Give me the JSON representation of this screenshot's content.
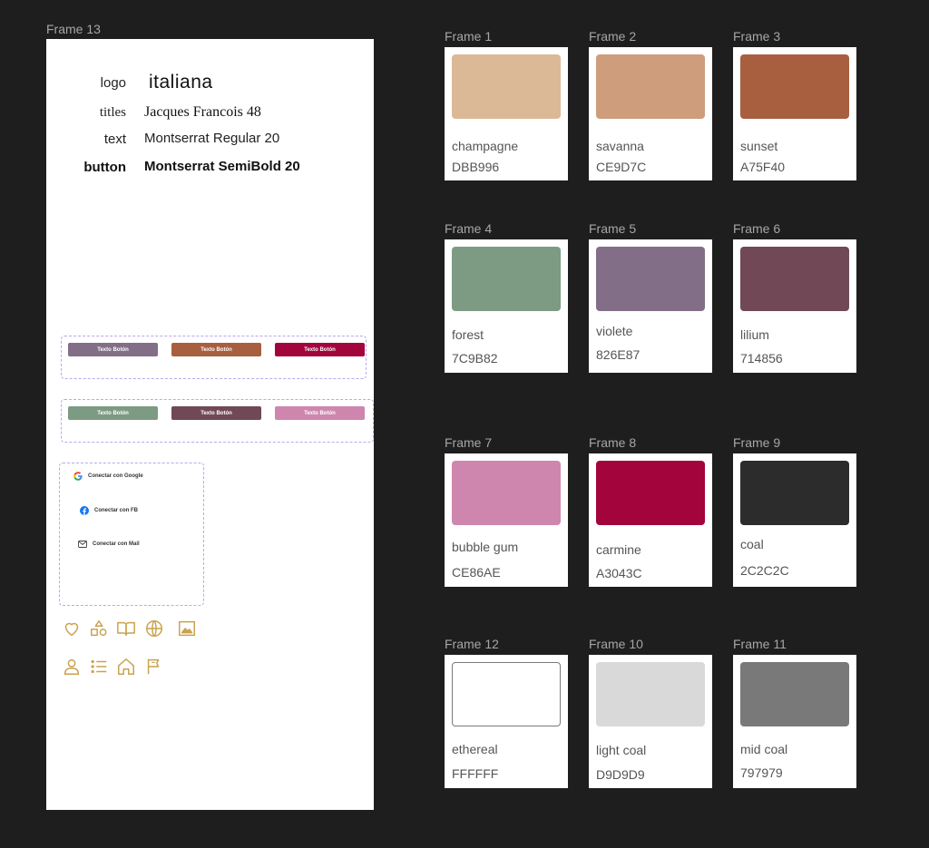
{
  "frame13": {
    "label": "Frame 13",
    "typography": [
      {
        "key": "logo",
        "value": "italiana"
      },
      {
        "key": "titles",
        "value": "Jacques Francois 48"
      },
      {
        "key": "text",
        "value": "Montserrat Regular 20"
      },
      {
        "key": "button",
        "value": "Montserrat SemiBold 20"
      }
    ],
    "buttons_row1": [
      {
        "label": "Texto Botón",
        "color": "#826E87"
      },
      {
        "label": "Texto Botón",
        "color": "#A75F40"
      },
      {
        "label": "Texto Botón",
        "color": "#A3043C"
      }
    ],
    "buttons_row2": [
      {
        "label": "Texto Botón",
        "color": "#7C9B82"
      },
      {
        "label": "Texto Botón",
        "color": "#714856"
      },
      {
        "label": "Texto Botón",
        "color": "#CE86AE"
      }
    ],
    "social": [
      {
        "label": "Conectar con Google",
        "icon": "google-icon"
      },
      {
        "label": "Conectar con FB",
        "icon": "facebook-icon"
      },
      {
        "label": "Conectar con Mail",
        "icon": "mail-icon"
      }
    ],
    "icon_color": "#C9A24D",
    "icons_row1": [
      "heart-icon",
      "shapes-icon",
      "book-icon",
      "globe-icon",
      "image-icon"
    ],
    "icons_row2": [
      "user-icon",
      "list-icon",
      "home-icon",
      "flag-icon"
    ]
  },
  "palette": [
    {
      "frame": "Frame 1",
      "name": "champagne",
      "hex": "DBB996",
      "color": "#DBB996"
    },
    {
      "frame": "Frame 2",
      "name": "savanna",
      "hex": "CE9D7C",
      "color": "#CE9D7C"
    },
    {
      "frame": "Frame 3",
      "name": "sunset",
      "hex": "A75F40",
      "color": "#A75F40"
    },
    {
      "frame": "Frame 4",
      "name": "forest",
      "hex": "7C9B82",
      "color": "#7C9B82"
    },
    {
      "frame": "Frame 5",
      "name": "violete",
      "hex": "826E87",
      "color": "#826E87"
    },
    {
      "frame": "Frame 6",
      "name": "lilium",
      "hex": "714856",
      "color": "#714856"
    },
    {
      "frame": "Frame 7",
      "name": "bubble gum",
      "hex": "CE86AE",
      "color": "#CE86AE"
    },
    {
      "frame": "Frame 8",
      "name": "carmine",
      "hex": "A3043C",
      "color": "#A3043C"
    },
    {
      "frame": "Frame 9",
      "name": "coal",
      "hex": "2C2C2C",
      "color": "#2C2C2C"
    },
    {
      "frame": "Frame 12",
      "name": "ethereal",
      "hex": "FFFFFF",
      "color": "#FFFFFF"
    },
    {
      "frame": "Frame 10",
      "name": "light coal",
      "hex": "D9D9D9",
      "color": "#D9D9D9"
    },
    {
      "frame": "Frame 11",
      "name": "mid coal",
      "hex": "797979",
      "color": "#797979"
    }
  ]
}
